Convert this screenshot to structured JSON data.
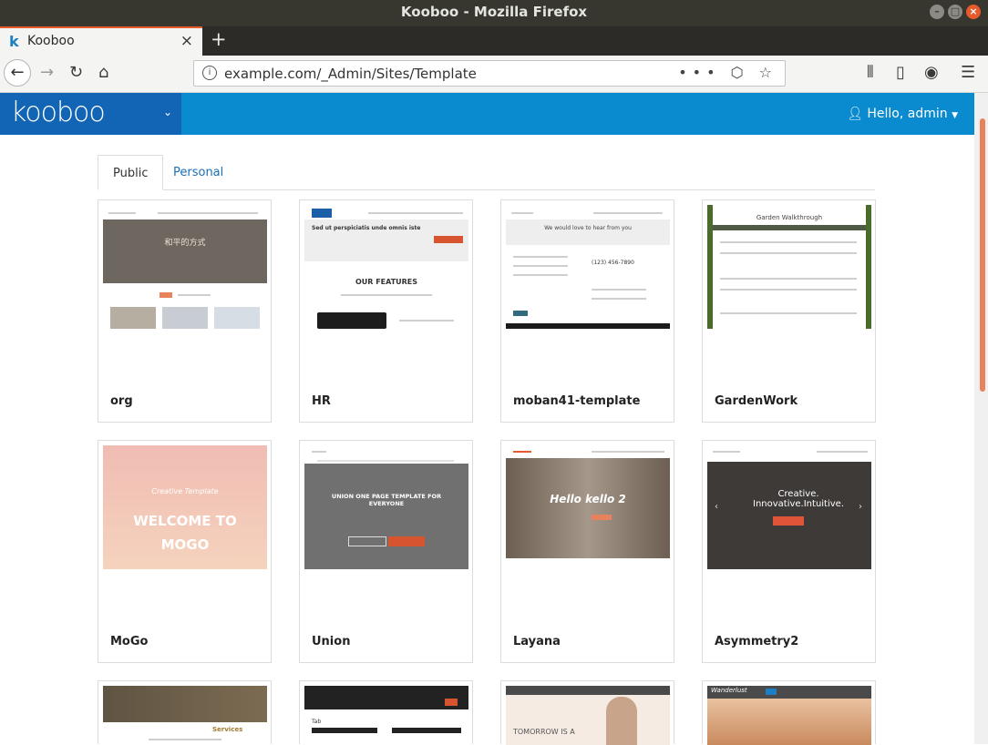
{
  "window": {
    "title": "Kooboo - Mozilla Firefox"
  },
  "browser": {
    "tab_title": "Kooboo",
    "url": "example.com/_Admin/Sites/Template",
    "url_actions": "••• ⬡ ☆"
  },
  "app": {
    "brand": "kooboo",
    "user_label": "Hello, admin"
  },
  "tabs": [
    {
      "label": "Public"
    },
    {
      "label": "Personal"
    }
  ],
  "templates": [
    {
      "name": "org",
      "thumb": {
        "bg": "#ffffff",
        "banner": "#6e675f",
        "banner_text": "和平的方式"
      }
    },
    {
      "name": "HR",
      "thumb": {
        "bg": "#ffffff",
        "banner": "#eeeeee",
        "banner_text": "Sed ut perspiciatis unde omnis iste",
        "section": "OUR FEATURES"
      }
    },
    {
      "name": "moban41-template",
      "thumb": {
        "bg": "#ffffff",
        "banner": "#eeeeee",
        "banner_text": "We would love to hear from you",
        "detail": "(123) 456-7890"
      }
    },
    {
      "name": "GardenWork",
      "thumb": {
        "bg": "#ffffff",
        "banner": "#4b6b2c",
        "banner_text": "Garden Walkthrough"
      }
    },
    {
      "name": "MoGo",
      "thumb": {
        "bg": "#f2c4b4",
        "banner": "#f2c4b4",
        "banner_text": "WELCOME TO MOGO",
        "sub": "Creative Template"
      }
    },
    {
      "name": "Union",
      "thumb": {
        "bg": "#707070",
        "banner": "#707070",
        "banner_text": "UNION ONE PAGE TEMPLATE FOR EVERYONE"
      }
    },
    {
      "name": "Layana",
      "thumb": {
        "bg": "#8b7d6e",
        "banner": "#8b7d6e",
        "banner_text": "Hello kello 2"
      }
    },
    {
      "name": "Asymmetry2",
      "thumb": {
        "bg": "#3d3a38",
        "banner": "#3d3a38",
        "banner_text": "Creative. Innovative.Intuitive."
      }
    },
    {
      "name": "",
      "thumb": {
        "bg": "#ffffff",
        "banner": "#5f5442",
        "banner_text": "Services"
      }
    },
    {
      "name": "",
      "thumb": {
        "bg": "#ffffff",
        "banner": "#222222",
        "banner_text": "Tab"
      }
    },
    {
      "name": "",
      "thumb": {
        "bg": "#f5ebe3",
        "banner": "#f5ebe3",
        "banner_text": "TOMORROW IS A"
      }
    },
    {
      "name": "",
      "thumb": {
        "bg": "#d8a982",
        "banner": "#4a4a4a",
        "banner_text": "Wanderlust"
      }
    }
  ],
  "colors": {
    "app_header": "#0a8bd0",
    "brand_block": "#1264b4",
    "accent": "#e65a2b"
  }
}
